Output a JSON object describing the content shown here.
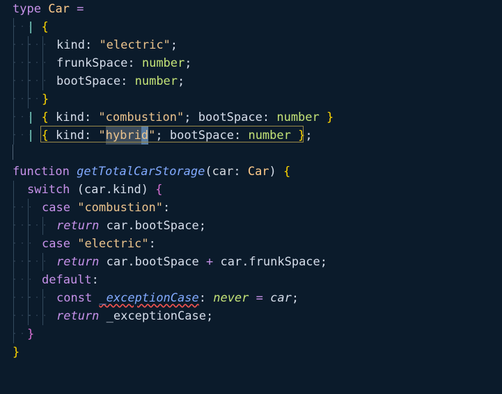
{
  "editor": {
    "lines": [
      {
        "t1": "type",
        "t2": "Car",
        "t3": "="
      },
      {
        "pipe": "|",
        "brace": "{"
      },
      {
        "prop": "kind",
        "str": "\"electric\""
      },
      {
        "prop": "frunkSpace",
        "type": "number"
      },
      {
        "prop": "bootSpace",
        "type": "number"
      },
      {
        "brace": "}"
      },
      {
        "pipe": "|",
        "prop1": "kind",
        "str": "\"combustion\"",
        "prop2": "bootSpace",
        "type": "number"
      },
      {
        "pipe": "|",
        "prop1": "kind",
        "str_pre": "\"",
        "str_sel": "hybri",
        "str_cur": "d",
        "str_post": "\"",
        "prop2": "bootSpace",
        "type": "number"
      },
      {},
      {
        "kw": "function",
        "fn": "getTotalCarStorage",
        "param": "car",
        "type": "Car"
      },
      {
        "kw": "switch",
        "expr": "car.kind"
      },
      {
        "kw": "case",
        "str": "\"combustion\""
      },
      {
        "kw": "return",
        "expr": "car.bootSpace"
      },
      {
        "kw": "case",
        "str": "\"electric\""
      },
      {
        "kw": "return",
        "expr1": "car.bootSpace",
        "op": "+",
        "expr2": "car.frunkSpace"
      },
      {
        "kw": "default"
      },
      {
        "kw": "const",
        "var": "_exceptionCase",
        "type": "never",
        "val": "car"
      },
      {
        "kw": "return",
        "var": "_exceptionCase"
      },
      {
        "brace": "}"
      },
      {
        "brace": "}"
      }
    ]
  },
  "colors": {
    "background": "#0b1b2b",
    "keyword": "#c792ea",
    "string": "#ecc48d",
    "type": "#c5e478",
    "function": "#82aaff",
    "brace": "#ffd700"
  }
}
